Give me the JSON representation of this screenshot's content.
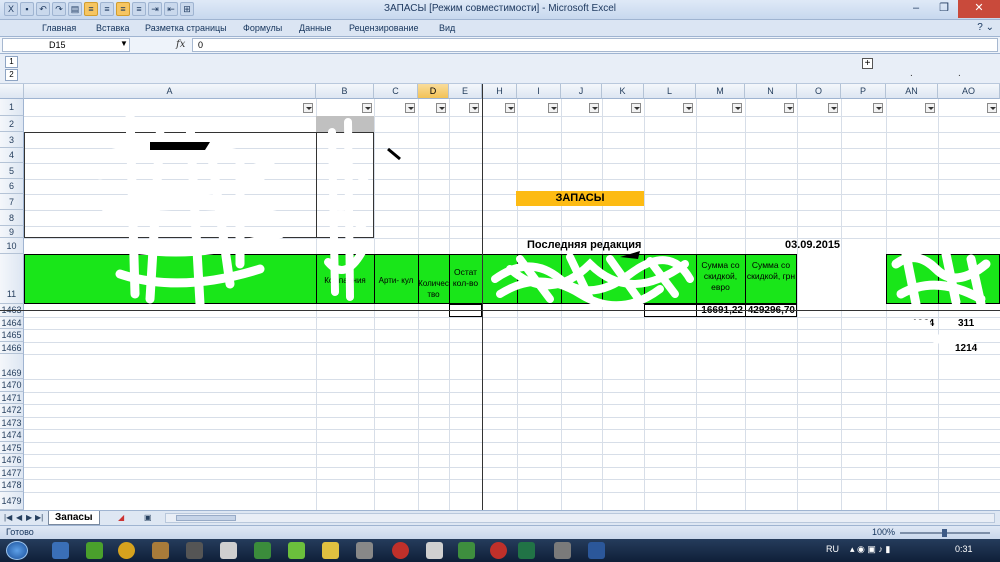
{
  "window": {
    "title": "ЗАПАСЫ  [Режим совместимости] - Microsoft Excel",
    "controls": [
      "–",
      "❐",
      "✕"
    ]
  },
  "ribbon": {
    "tabs": [
      "Главная",
      "Вставка",
      "Разметка страницы",
      "Формулы",
      "Данные",
      "Рецензирование",
      "Вид"
    ]
  },
  "formula_bar": {
    "name_box": "D15",
    "fx": "fx",
    "value": "0"
  },
  "outline": {
    "levels": [
      "1",
      "2"
    ],
    "expand": "+"
  },
  "columns": [
    "A",
    "B",
    "C",
    "D",
    "E",
    "H",
    "I",
    "J",
    "K",
    "L",
    "M",
    "N",
    "O",
    "P",
    "AN",
    "AO"
  ],
  "selected_column": "D",
  "rows": [
    "1",
    "2",
    "3",
    "4",
    "5",
    "6",
    "7",
    "8",
    "9",
    "10",
    "11",
    "1463",
    "1464",
    "1465",
    "1466",
    "1469",
    "1470",
    "1471",
    "1472",
    "1473",
    "1474",
    "1475",
    "1476",
    "1477",
    "1478",
    "1479"
  ],
  "cells": {
    "banner": "ЗАПАСЫ",
    "last_edit_label": "Последняя редакция",
    "last_edit_date": "03.09.2015",
    "header_naimenovanie": "Наименование",
    "header_kompaniya": "Компа- ния",
    "header_artikul": "Арти- кул",
    "header_kolichestvo": "Количество",
    "header_ostat": "Остат кол-во",
    "header_sum_eur": "Сумма со скидкой, евро",
    "header_sum_uah": "Сумма со скидкой, грн",
    "total_eur": "16691,22",
    "total_uah": "429296,70",
    "ao_value_1": "1364",
    "ao_value_2": "311",
    "ao_value_3": "1214"
  },
  "sheet_tabs": {
    "active": "Запасы"
  },
  "status": {
    "ready": "Готово",
    "zoom": "100%"
  },
  "taskbar": {
    "lang": "RU",
    "time": "0:31"
  }
}
